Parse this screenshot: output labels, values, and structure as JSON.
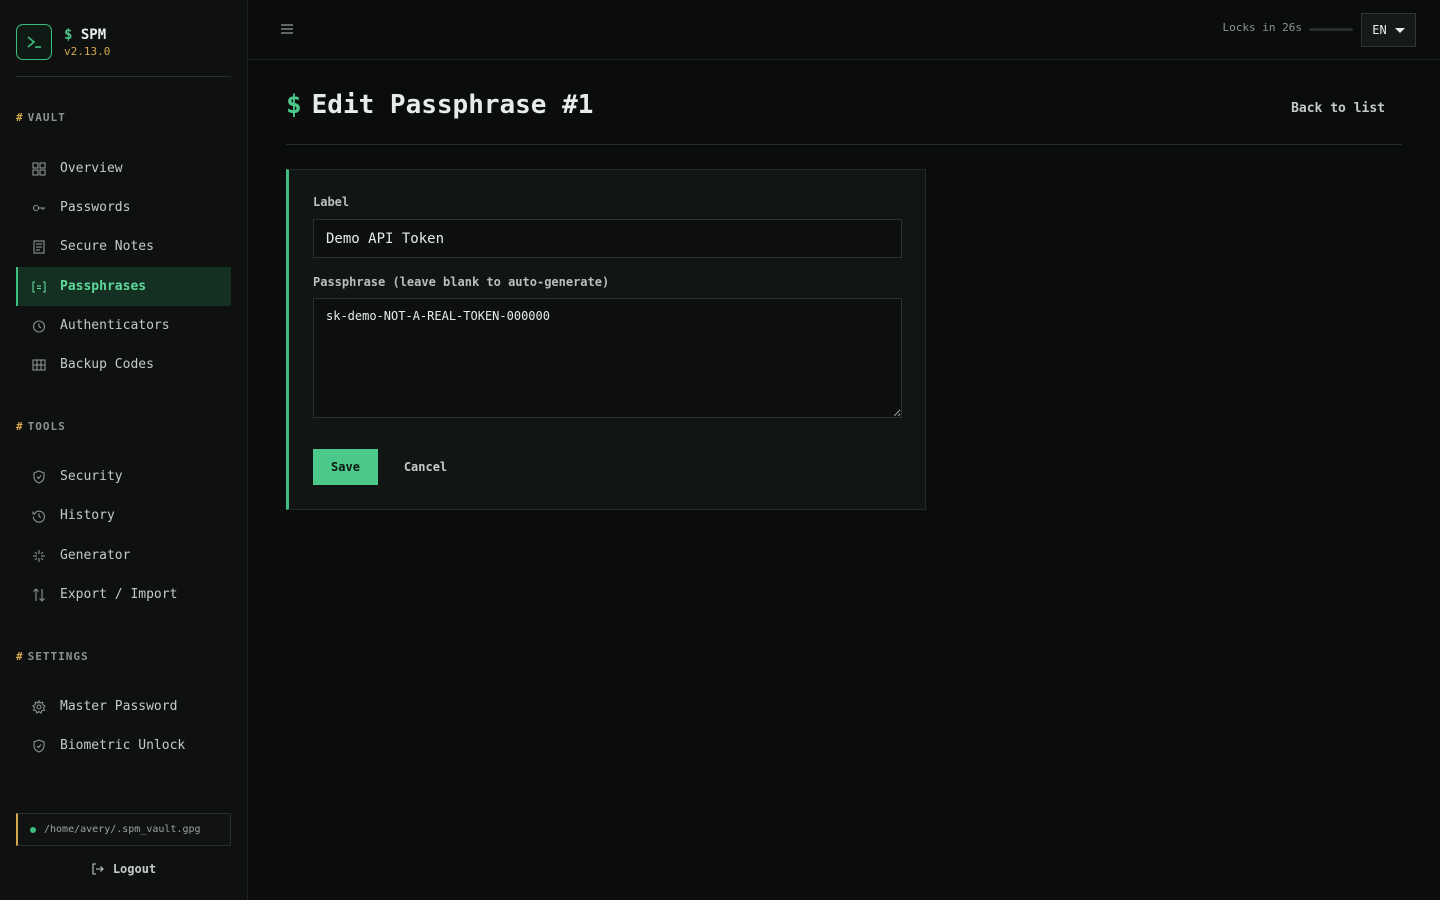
{
  "brand": {
    "name_prefix": "$",
    "name": "SPM",
    "version": "v2.13.0"
  },
  "sections": {
    "vault": {
      "hash": "#",
      "title": "VAULT"
    },
    "tools": {
      "hash": "#",
      "title": "TOOLS"
    },
    "settings": {
      "hash": "#",
      "title": "SETTINGS"
    }
  },
  "nav": {
    "overview": {
      "label": "Overview",
      "icon": "grid-icon"
    },
    "passwords": {
      "label": "Passwords",
      "icon": "key-icon"
    },
    "secure_notes": {
      "label": "Secure Notes",
      "icon": "note-icon"
    },
    "passphrases": {
      "label": "Passphrases",
      "icon": "bracket-list-icon",
      "active": true
    },
    "authenticators": {
      "label": "Authenticators",
      "icon": "clock-icon"
    },
    "backup_codes": {
      "label": "Backup Codes",
      "icon": "table-icon"
    },
    "security": {
      "label": "Security",
      "icon": "shield-icon"
    },
    "history": {
      "label": "History",
      "icon": "history-icon"
    },
    "generator": {
      "label": "Generator",
      "icon": "sparkle-icon"
    },
    "export_import": {
      "label": "Export / Import",
      "icon": "arrows-updown-icon"
    },
    "master_password": {
      "label": "Master Password",
      "icon": "gear-icon"
    },
    "biometric_unlock": {
      "label": "Biometric Unlock",
      "icon": "shield-icon"
    }
  },
  "vault_path": "/home/avery/.spm_vault.gpg",
  "logout_label": "Logout",
  "topbar": {
    "locks_text": "Locks in 26s",
    "lock_progress": 0,
    "language": "EN"
  },
  "page": {
    "title_prefix": "$",
    "title": "Edit Passphrase #1",
    "back_label": "Back to list"
  },
  "form": {
    "label_label": "Label",
    "label_value": "Demo API Token",
    "passphrase_label": "Passphrase (leave blank to auto-generate)",
    "passphrase_value": "sk-demo-NOT-A-REAL-TOKEN-000000",
    "save_label": "Save",
    "cancel_label": "Cancel"
  },
  "colors": {
    "accent": "#3fbf7f",
    "accent_text": "#5fd99a",
    "warning": "#d4a84b",
    "background": "#0b0d0d"
  }
}
